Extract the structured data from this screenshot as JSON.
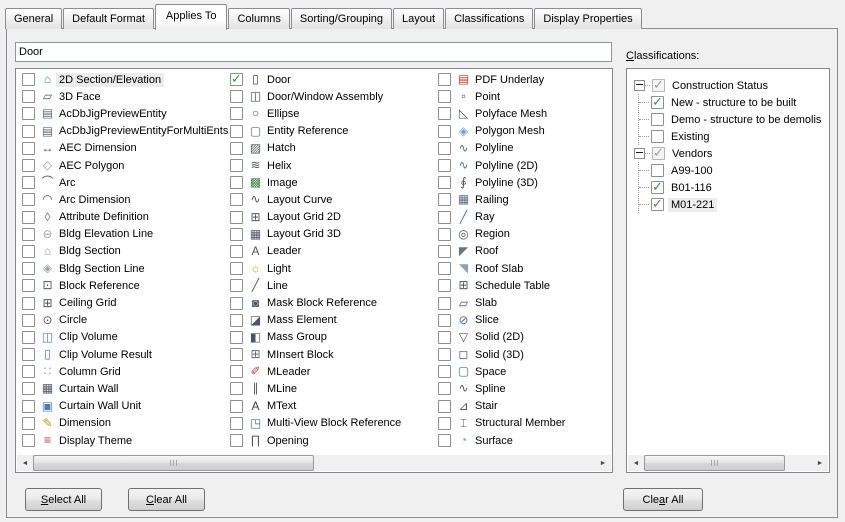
{
  "tabs": [
    {
      "label": "General",
      "active": false
    },
    {
      "label": "Default Format",
      "active": false
    },
    {
      "label": "Applies To",
      "active": true
    },
    {
      "label": "Columns",
      "active": false
    },
    {
      "label": "Sorting/Grouping",
      "active": false
    },
    {
      "label": "Layout",
      "active": false
    },
    {
      "label": "Classifications",
      "active": false
    },
    {
      "label": "Display Properties",
      "active": false
    }
  ],
  "filter": {
    "value": "Door"
  },
  "applies_to": {
    "columns": [
      {
        "items": [
          {
            "label": "2D Section/Elevation",
            "icon": "section-elevation-2d-icon",
            "glyph": "⌂",
            "color": "#4d79bd",
            "focused": true
          },
          {
            "label": "3D Face",
            "icon": "face-3d-icon",
            "glyph": "▱",
            "color": "#4b5563"
          },
          {
            "label": "AcDbJigPreviewEntity",
            "icon": "jig-preview-entity-icon",
            "glyph": "▤",
            "color": "#5a6b7d"
          },
          {
            "label": "AcDbJigPreviewEntityForMultiEnts",
            "icon": "jig-preview-entity-multi-icon",
            "glyph": "▤",
            "color": "#5a6b7d"
          },
          {
            "label": "AEC Dimension",
            "icon": "aec-dimension-icon",
            "glyph": "↔",
            "color": "#4b5563"
          },
          {
            "label": "AEC Polygon",
            "icon": "aec-polygon-icon",
            "glyph": "◇",
            "color": "#8d99a6"
          },
          {
            "label": "Arc",
            "icon": "arc-icon",
            "glyph": "⌒",
            "color": "#4b5563"
          },
          {
            "label": "Arc Dimension",
            "icon": "arc-dimension-icon",
            "glyph": "◠",
            "color": "#4b5563"
          },
          {
            "label": "Attribute Definition",
            "icon": "attribute-definition-icon",
            "glyph": "◊",
            "color": "#6b7280"
          },
          {
            "label": "Bldg Elevation Line",
            "icon": "bldg-elevation-line-icon",
            "glyph": "⊖",
            "color": "#9aa3ad"
          },
          {
            "label": "Bldg Section",
            "icon": "bldg-section-icon",
            "glyph": "⌂",
            "color": "#8d99a6"
          },
          {
            "label": "Bldg Section Line",
            "icon": "bldg-section-line-icon",
            "glyph": "◈",
            "color": "#9aa3ad"
          },
          {
            "label": "Block Reference",
            "icon": "block-reference-icon",
            "glyph": "⊡",
            "color": "#4b5563"
          },
          {
            "label": "Ceiling Grid",
            "icon": "ceiling-grid-icon",
            "glyph": "⊞",
            "color": "#4b5563"
          },
          {
            "label": "Circle",
            "icon": "circle-icon",
            "glyph": "⊙",
            "color": "#4b5563"
          },
          {
            "label": "Clip Volume",
            "icon": "clip-volume-icon",
            "glyph": "◫",
            "color": "#4d79bd"
          },
          {
            "label": "Clip Volume Result",
            "icon": "clip-volume-result-icon",
            "glyph": "▯",
            "color": "#4d79bd"
          },
          {
            "label": "Column Grid",
            "icon": "column-grid-icon",
            "glyph": "∷",
            "color": "#8d99a6"
          },
          {
            "label": "Curtain Wall",
            "icon": "curtain-wall-icon",
            "glyph": "▦",
            "color": "#4b5563"
          },
          {
            "label": "Curtain Wall Unit",
            "icon": "curtain-wall-unit-icon",
            "glyph": "▣",
            "color": "#4d79bd"
          },
          {
            "label": "Dimension",
            "icon": "dimension-icon",
            "glyph": "✎",
            "color": "#c29114"
          },
          {
            "label": "Display Theme",
            "icon": "display-theme-icon",
            "glyph": "≡",
            "color": "#c0392b"
          }
        ]
      },
      {
        "items": [
          {
            "label": "Door",
            "icon": "door-icon",
            "glyph": "▯",
            "color": "#3c4a63",
            "checked": true
          },
          {
            "label": "Door/Window Assembly",
            "icon": "door-window-assembly-icon",
            "glyph": "◫",
            "color": "#3c4a63"
          },
          {
            "label": "Ellipse",
            "icon": "ellipse-icon",
            "glyph": "○",
            "color": "#4b5563"
          },
          {
            "label": "Entity Reference",
            "icon": "entity-reference-icon",
            "glyph": "▢",
            "color": "#5a6b7d"
          },
          {
            "label": "Hatch",
            "icon": "hatch-icon",
            "glyph": "▨",
            "color": "#4b5563"
          },
          {
            "label": "Helix",
            "icon": "helix-icon",
            "glyph": "≋",
            "color": "#4b5563"
          },
          {
            "label": "Image",
            "icon": "image-icon",
            "glyph": "▩",
            "color": "#3f7f3f"
          },
          {
            "label": "Layout Curve",
            "icon": "layout-curve-icon",
            "glyph": "∿",
            "color": "#4b5563"
          },
          {
            "label": "Layout Grid 2D",
            "icon": "layout-grid-2d-icon",
            "glyph": "⊞",
            "color": "#4b5563"
          },
          {
            "label": "Layout Grid 3D",
            "icon": "layout-grid-3d-icon",
            "glyph": "▦",
            "color": "#4b5563"
          },
          {
            "label": "Leader",
            "icon": "leader-icon",
            "glyph": "A",
            "color": "#4b5563"
          },
          {
            "label": "Light",
            "icon": "light-icon",
            "glyph": "☼",
            "color": "#e0a010"
          },
          {
            "label": "Line",
            "icon": "line-icon",
            "glyph": "╱",
            "color": "#4b5563"
          },
          {
            "label": "Mask Block Reference",
            "icon": "mask-block-reference-icon",
            "glyph": "◙",
            "color": "#4b5563"
          },
          {
            "label": "Mass Element",
            "icon": "mass-element-icon",
            "glyph": "◪",
            "color": "#4b5563"
          },
          {
            "label": "Mass Group",
            "icon": "mass-group-icon",
            "glyph": "◧",
            "color": "#4b5563"
          },
          {
            "label": "MInsert Block",
            "icon": "minsert-block-icon",
            "glyph": "⊞",
            "color": "#5a6b7d"
          },
          {
            "label": "MLeader",
            "icon": "mleader-icon",
            "glyph": "✐",
            "color": "#b04030"
          },
          {
            "label": "MLine",
            "icon": "mline-icon",
            "glyph": "∥",
            "color": "#4b5563"
          },
          {
            "label": "MText",
            "icon": "mtext-icon",
            "glyph": "A",
            "color": "#374151"
          },
          {
            "label": "Multi-View Block Reference",
            "icon": "multi-view-block-reference-icon",
            "glyph": "◳",
            "color": "#5a6b7d"
          },
          {
            "label": "Opening",
            "icon": "opening-icon",
            "glyph": "∏",
            "color": "#4b5563"
          }
        ]
      },
      {
        "items": [
          {
            "label": "PDF Underlay",
            "icon": "pdf-underlay-icon",
            "glyph": "▤",
            "color": "#c0392b"
          },
          {
            "label": "Point",
            "icon": "point-icon",
            "glyph": "▫",
            "color": "#4b5563"
          },
          {
            "label": "Polyface Mesh",
            "icon": "polyface-mesh-icon",
            "glyph": "◺",
            "color": "#4b5563"
          },
          {
            "label": "Polygon Mesh",
            "icon": "polygon-mesh-icon",
            "glyph": "◈",
            "color": "#6f9fd8"
          },
          {
            "label": "Polyline",
            "icon": "polyline-icon",
            "glyph": "∿",
            "color": "#3f6fb5"
          },
          {
            "label": "Polyline (2D)",
            "icon": "polyline-2d-icon",
            "glyph": "∿",
            "color": "#3f6fb5"
          },
          {
            "label": "Polyline (3D)",
            "icon": "polyline-3d-icon",
            "glyph": "∮",
            "color": "#4b5563"
          },
          {
            "label": "Railing",
            "icon": "railing-icon",
            "glyph": "▦",
            "color": "#5a6b7d"
          },
          {
            "label": "Ray",
            "icon": "ray-icon",
            "glyph": "╱",
            "color": "#3f6fb5"
          },
          {
            "label": "Region",
            "icon": "region-icon",
            "glyph": "◎",
            "color": "#4b5563"
          },
          {
            "label": "Roof",
            "icon": "roof-icon",
            "glyph": "◤",
            "color": "#6a7687"
          },
          {
            "label": "Roof Slab",
            "icon": "roof-slab-icon",
            "glyph": "◥",
            "color": "#8fa3b8"
          },
          {
            "label": "Schedule Table",
            "icon": "schedule-table-icon",
            "glyph": "⊞",
            "color": "#4b5563"
          },
          {
            "label": "Slab",
            "icon": "slab-icon",
            "glyph": "▱",
            "color": "#4b5563"
          },
          {
            "label": "Slice",
            "icon": "slice-icon",
            "glyph": "⊘",
            "color": "#3f6fb5"
          },
          {
            "label": "Solid (2D)",
            "icon": "solid-2d-icon",
            "glyph": "▽",
            "color": "#4b5563"
          },
          {
            "label": "Solid (3D)",
            "icon": "solid-3d-icon",
            "glyph": "◻",
            "color": "#4b5563"
          },
          {
            "label": "Space",
            "icon": "space-icon",
            "glyph": "▢",
            "color": "#3f6fb5"
          },
          {
            "label": "Spline",
            "icon": "spline-icon",
            "glyph": "∿",
            "color": "#4b5563"
          },
          {
            "label": "Stair",
            "icon": "stair-icon",
            "glyph": "⊿",
            "color": "#4b5563"
          },
          {
            "label": "Structural Member",
            "icon": "structural-member-icon",
            "glyph": "⌶",
            "color": "#4b5563"
          },
          {
            "label": "Surface",
            "icon": "surface-icon",
            "glyph": "◔",
            "color": "#6f9fd8"
          }
        ]
      }
    ]
  },
  "classifications": {
    "label_key": "C",
    "label_rest": "lassifications:",
    "tree": [
      {
        "label": "Construction Status",
        "state": "mixed",
        "expanded": true,
        "children": [
          {
            "label": "New - structure to be built",
            "state": "checked"
          },
          {
            "label": "Demo - structure to be demolis",
            "state": "unchecked"
          },
          {
            "label": "Existing",
            "state": "unchecked"
          }
        ]
      },
      {
        "label": "Vendors",
        "state": "mixed",
        "expanded": true,
        "children": [
          {
            "label": "A99-100",
            "state": "unchecked"
          },
          {
            "label": "B01-116",
            "state": "checked"
          },
          {
            "label": "M01-221",
            "state": "checked",
            "selected": true
          }
        ]
      }
    ]
  },
  "scrollbars": {
    "main_list": {
      "thumb_left_pct": 0,
      "thumb_width_pct": 50
    },
    "classifications": {
      "thumb_left_pct": 0,
      "thumb_width_pct": 84
    }
  },
  "buttons": {
    "select_all": {
      "pre": "",
      "key": "S",
      "post": "elect All"
    },
    "clear_all": {
      "pre": "",
      "key": "C",
      "post": "lear All"
    },
    "clear_all_right": {
      "pre": "Cle",
      "key": "a",
      "post": "r All"
    }
  }
}
